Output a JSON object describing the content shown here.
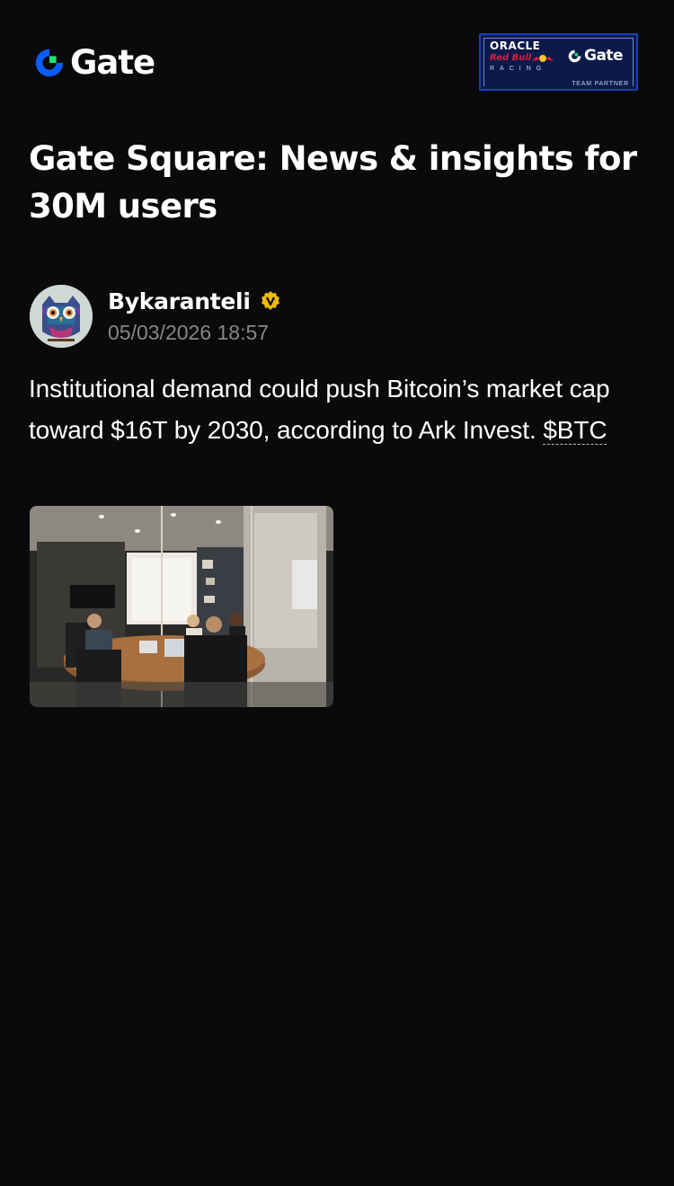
{
  "header": {
    "brand_name": "Gate",
    "partner_badge": {
      "line1": "ORACLE",
      "line2": "Red Bull",
      "line3": "RACING",
      "brand": "Gate",
      "caption": "TEAM PARTNER"
    }
  },
  "page": {
    "title": "Gate Square: News & insights for 30M users"
  },
  "post": {
    "author": "Bykaranteli",
    "verified_icon": "verified-badge-icon",
    "timestamp": "05/03/2026 18:57",
    "body": "Institutional demand could push Bitcoin’s market cap toward $16T by 2030, according to Ark Invest. ",
    "ticker": "$BTC",
    "image": "office-meeting-photo"
  },
  "colors": {
    "background": "#0a0a0b",
    "brand_blue": "#0a5cff",
    "brand_green": "#17e66f",
    "verified_gold": "#f0b90b",
    "muted_text": "#86868c"
  }
}
